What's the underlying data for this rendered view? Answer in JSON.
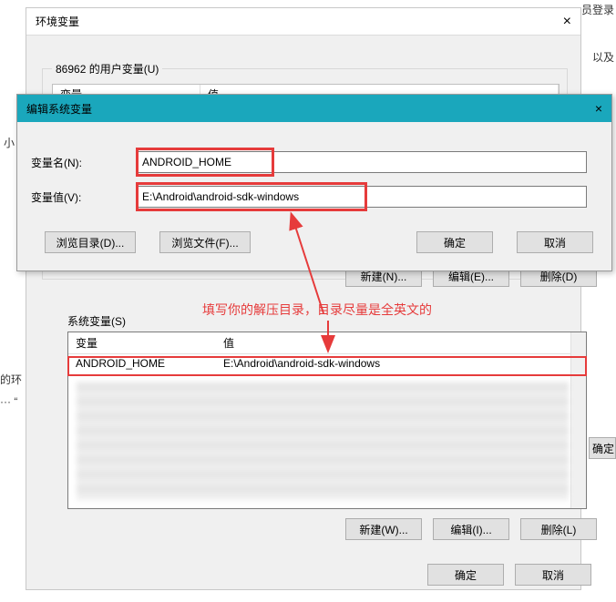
{
  "frag": {
    "top_right": "员登录",
    "and": "以及",
    "left1": "小",
    "left2": "的环",
    "left3": "···  “"
  },
  "bg": {
    "title": "环境变量",
    "close": "×",
    "user_group": "86962 的用户变量(U)",
    "col_var": "变量",
    "col_val": "值",
    "sys_group": "系统变量(S)",
    "sys_rows": [
      {
        "var": "ANDROID_HOME",
        "val": "E:\\Android\\android-sdk-windows"
      }
    ],
    "btn_new": "新建(N)...",
    "btn_edit": "编辑(E)...",
    "btn_del": "删除(D)",
    "btn_new2": "新建(W)...",
    "btn_edit2": "编辑(I)...",
    "btn_del2": "删除(L)",
    "btn_ok": "确定",
    "btn_cancel": "取消"
  },
  "fg": {
    "title": "编辑系统变量",
    "close": "×",
    "name_label": "变量名(N):",
    "name_value": "ANDROID_HOME",
    "val_label": "变量值(V):",
    "val_value": "E:\\Android\\android-sdk-windows",
    "btn_browse_dir": "浏览目录(D)...",
    "btn_browse_file": "浏览文件(F)...",
    "btn_ok": "确定",
    "btn_cancel": "取消"
  },
  "annotation": "填写你的解压目录，目录尽量是全英文的",
  "side_ok": "确定"
}
